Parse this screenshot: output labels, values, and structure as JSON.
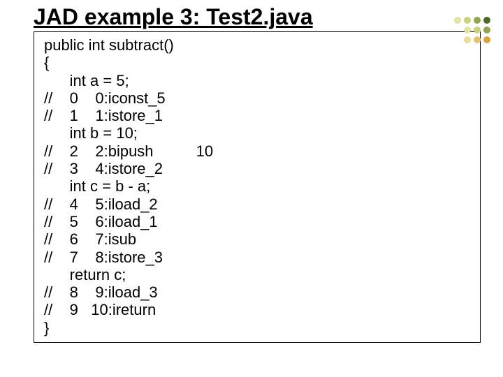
{
  "title": "JAD example 3: Test2.java",
  "code": {
    "lines": [
      "public int subtract()",
      "{",
      "      int a = 5;",
      "//    0    0:iconst_5",
      "//    1    1:istore_1",
      "      int b = 10;",
      "//    2    2:bipush          10",
      "//    3    4:istore_2",
      "      int c = b - a;",
      "//    4    5:iload_2",
      "//    5    6:iload_1",
      "//    6    7:isub",
      "//    7    8:istore_3",
      "      return c;",
      "//    8    9:iload_3",
      "//    9   10:ireturn",
      "}"
    ]
  }
}
